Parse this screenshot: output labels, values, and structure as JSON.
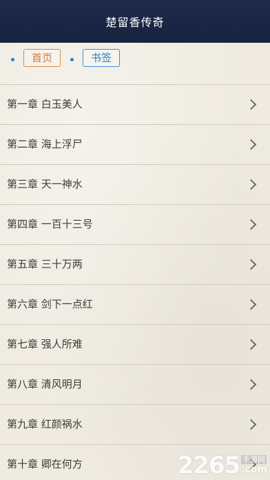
{
  "header": {
    "title": "楚留香传奇"
  },
  "tabs": {
    "home_label": "首页",
    "bookmark_label": "书签"
  },
  "chapters": [
    {
      "label": "第一章 白玉美人"
    },
    {
      "label": "第二章 海上浮尸"
    },
    {
      "label": "第三章 天一神水"
    },
    {
      "label": "第四章 一百十三号"
    },
    {
      "label": "第五章 三十万两"
    },
    {
      "label": "第六章 剑下一点红"
    },
    {
      "label": "第七章 强人所难"
    },
    {
      "label": "第八章 清风明月"
    },
    {
      "label": "第九章 红颜祸水"
    },
    {
      "label": "第十章 卿在何方"
    }
  ],
  "watermark": {
    "number": "2265",
    "site_cn": "手游网",
    "suffix": ".com"
  },
  "colors": {
    "header_bg": "#1d2a48",
    "home_tab": "#d4782c",
    "bookmark_tab": "#2f7fc8"
  }
}
